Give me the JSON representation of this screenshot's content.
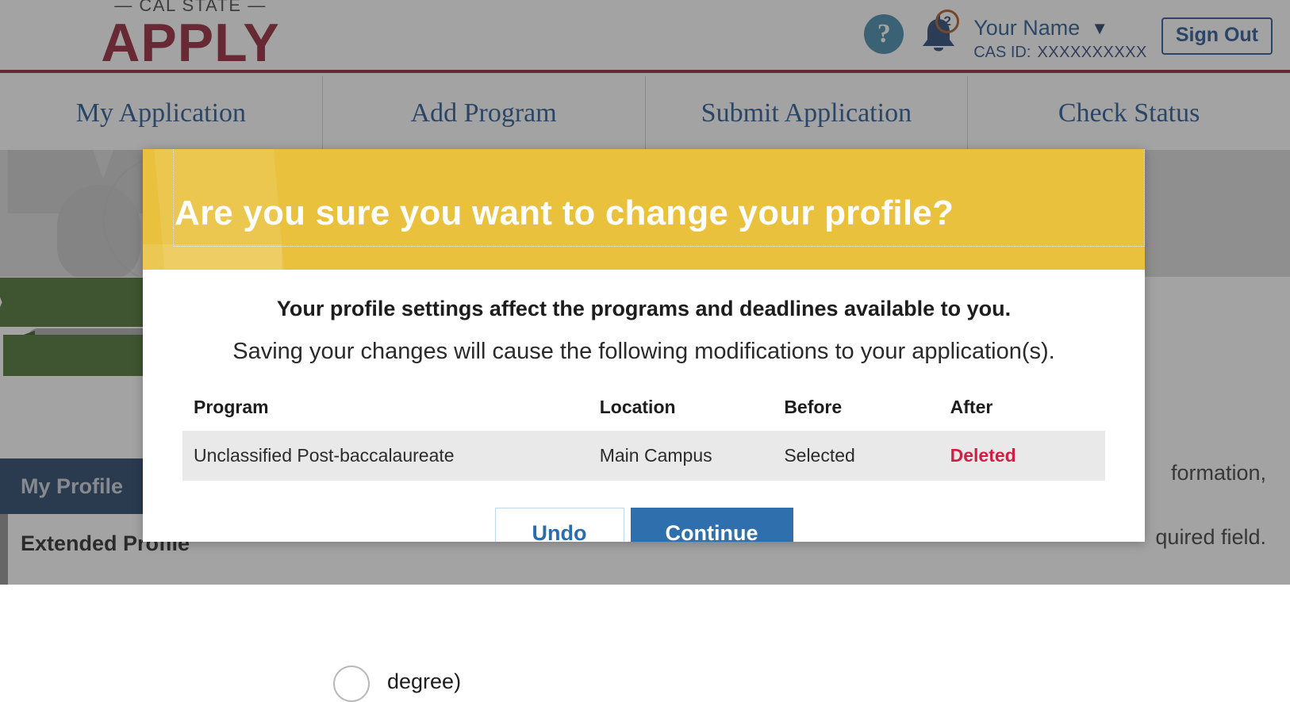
{
  "header": {
    "logo_top": "— CAL STATE —",
    "logo_main": "APPLY",
    "help_icon": "question-mark-icon",
    "notifications": {
      "icon": "bell-icon",
      "count": "2"
    },
    "user_name": "Your Name",
    "user_chevron": "chevron-down-icon",
    "cas_id_label": "CAS ID:",
    "cas_id_value": "XXXXXXXXXX",
    "sign_out": "Sign Out",
    "accent_red": "#8e1b2e",
    "accent_blue": "#1d4f8c"
  },
  "nav": {
    "items": [
      {
        "label": "My Application"
      },
      {
        "label": "Add Program"
      },
      {
        "label": "Submit Application"
      },
      {
        "label": "Check Status"
      }
    ]
  },
  "background": {
    "my_profile": "My Profile",
    "extended_profile": "Extended Profile",
    "degree_fragment": "degree)",
    "right_fragment_1": "formation,",
    "right_fragment_2": "quired field.",
    "banner_color": "#436b26",
    "profile_bar_color": "#1b3a61"
  },
  "modal": {
    "title": "Are you sure you want to change your profile?",
    "header_color": "#e9c13c",
    "line_1": "Your profile settings affect the programs and deadlines available to you.",
    "line_2": "Saving your changes will cause the following modifications to your application(s).",
    "table": {
      "columns": [
        "Program",
        "Location",
        "Before",
        "After"
      ],
      "rows": [
        {
          "program": "Unclassified Post-baccalaureate",
          "location": "Main Campus",
          "before": "Selected",
          "after": "Deleted"
        }
      ],
      "after_color": "#cf1f45"
    },
    "buttons": {
      "undo": "Undo",
      "continue": "Continue",
      "continue_color": "#2f6fad"
    }
  }
}
